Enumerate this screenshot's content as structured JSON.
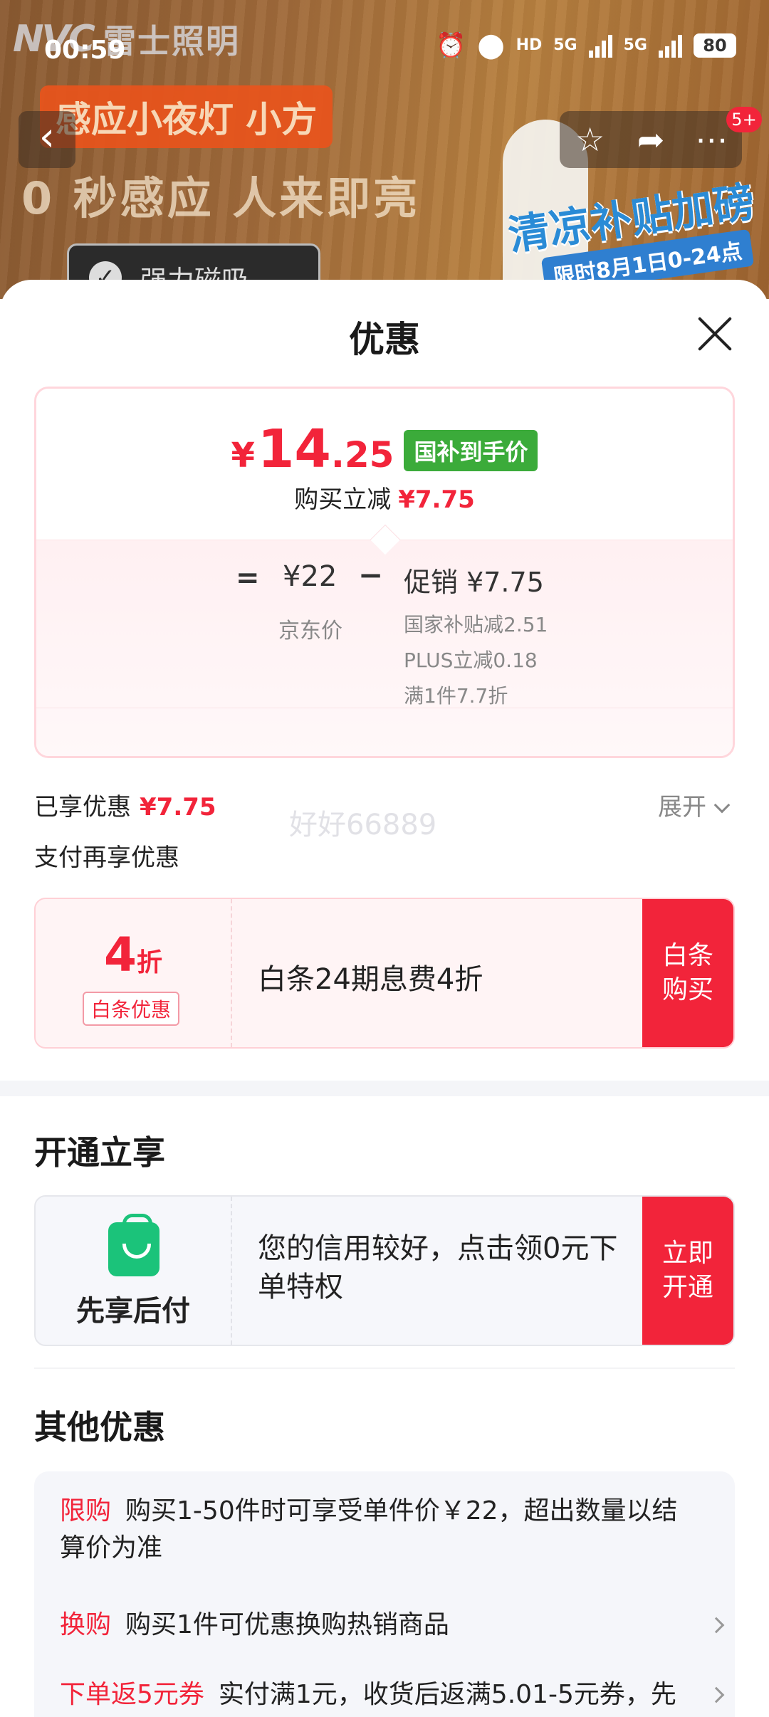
{
  "status_bar": {
    "time": "00:59",
    "network_a": "5G",
    "network_b": "5G",
    "hd": "HD",
    "battery": "80"
  },
  "banner": {
    "brand_mark": "NVC",
    "brand_name": "雷士照明",
    "chip": "感应小夜灯 小方",
    "slogan": "0 秒感应  人来即亮",
    "feature": "强力磁吸",
    "promo": "清凉补贴加磅",
    "promo_sub": "限时8月1日0-24点",
    "cart_badge": "5+"
  },
  "sheet": {
    "title": "优惠",
    "price_card": {
      "currency": "¥",
      "final_int": "14",
      "final_dec": ".25",
      "final_tag": "国补到手价",
      "reduce_label": "购买立减",
      "reduce_value": "¥7.75",
      "eq": "=",
      "jd_price": "¥22",
      "jd_label": "京东价",
      "minus": "−",
      "promo_sum": "促销 ¥7.75",
      "promo_lines": [
        "国家补贴减2.51",
        "PLUS立减0.18",
        "满1件7.7折"
      ]
    },
    "enjoyed_label": "已享优惠",
    "enjoyed_value": "¥7.75",
    "expand_label": "展开",
    "watermark": "好好66889",
    "pay_more_label": "支付再享优惠",
    "coupon": {
      "discount_num": "4",
      "discount_unit": "折",
      "tag": "白条优惠",
      "desc": "白条24期息费4折",
      "button": "白条购买"
    },
    "open_section": {
      "title": "开通立享",
      "card_title": "先享后付",
      "desc": "您的信用较好，点击领0元下单特权",
      "button": "立即开通"
    },
    "other_section": {
      "title": "其他优惠",
      "items": [
        {
          "tag": "限购",
          "text": "购买1-50件时可享受单件价￥22，超出数量以结算价为准"
        },
        {
          "tag": "换购",
          "text": "购买1件可优惠换购热销商品"
        },
        {
          "tag": "下单返5元券",
          "text": "实付满1元，收货后返满5.01-5元券，先"
        }
      ]
    }
  },
  "colors": {
    "accent_red": "#f2243a",
    "tag_green": "#3bab3a",
    "bag_green": "#1bc37a"
  }
}
